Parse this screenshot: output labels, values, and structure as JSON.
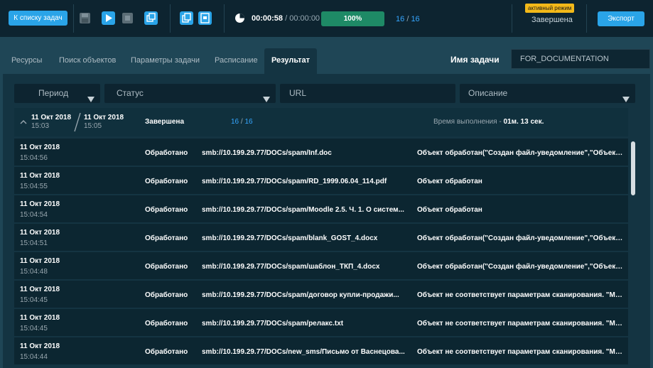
{
  "toolbar": {
    "back_label": "К списку задач",
    "time_current": "00:00:58",
    "time_separator": "/",
    "time_total": "00:00:00",
    "progress_label": "100%",
    "progress_value": 1.0,
    "count_done": "16",
    "count_separator": "/",
    "count_total": "16",
    "mode_badge": "активный режим",
    "mode_status": "Завершена",
    "export_label": "Экспорт",
    "icons": [
      "save-icon",
      "play-icon",
      "stop-icon",
      "copy-windows-icon",
      "copy-icon",
      "document-icon",
      "timer-icon"
    ]
  },
  "tabs": [
    {
      "label": "Ресурсы"
    },
    {
      "label": "Поиск объектов"
    },
    {
      "label": "Параметры задачи"
    },
    {
      "label": "Расписание"
    },
    {
      "label": "Результат",
      "active": true
    }
  ],
  "task": {
    "name_label": "Имя задачи",
    "name_value": "FOR_DOCUMENTATION"
  },
  "filters": {
    "period": "Период",
    "status": "Статус",
    "url": "URL",
    "description": "Описание"
  },
  "group": {
    "start_date": "11 Окт 2018",
    "start_time": "15:03",
    "end_date": "11 Окт 2018",
    "end_time": "15:05",
    "status": "Завершена",
    "count_done": "16",
    "count_separator": "/",
    "count_total": "16",
    "exec_label": "Время выполнения",
    "exec_dash": "-",
    "exec_value": "01м. 13 сек."
  },
  "rows": [
    {
      "date": "11 Окт 2018",
      "time": "15:04:56",
      "status": "Обработано",
      "url": "smb://10.199.29.77/DOCs/spam/Inf.doc",
      "desc": "Объект обработан(\"Создан файл-уведомление\",\"Объект п..."
    },
    {
      "date": "11 Окт 2018",
      "time": "15:04:55",
      "status": "Обработано",
      "url": "smb://10.199.29.77/DOCs/spam/RD_1999.06.04_114.pdf",
      "desc": "Объект обработан"
    },
    {
      "date": "11 Окт 2018",
      "time": "15:04:54",
      "status": "Обработано",
      "url": "smb://10.199.29.77/DOCs/spam/Moodle 2.5. Ч. 1. О систем...",
      "desc": "Объект обработан"
    },
    {
      "date": "11 Окт 2018",
      "time": "15:04:51",
      "status": "Обработано",
      "url": "smb://10.199.29.77/DOCs/spam/blank_GOST_4.docx",
      "desc": "Объект обработан(\"Создан файл-уведомление\",\"Объект п..."
    },
    {
      "date": "11 Окт 2018",
      "time": "15:04:48",
      "status": "Обработано",
      "url": "smb://10.199.29.77/DOCs/spam/шаблон_ТКП_4.docx",
      "desc": "Объект обработан(\"Создан файл-уведомление\",\"Объект п..."
    },
    {
      "date": "11 Окт 2018",
      "time": "15:04:45",
      "status": "Обработано",
      "url": "smb://10.199.29.77/DOCs/spam/договор купли-продажи...",
      "desc": "Объект не соответствует параметрам сканирования. \"Мет..."
    },
    {
      "date": "11 Окт 2018",
      "time": "15:04:45",
      "status": "Обработано",
      "url": "smb://10.199.29.77/DOCs/spam/релакс.txt",
      "desc": "Объект не соответствует параметрам сканирования. \"Мет..."
    },
    {
      "date": "11 Окт 2018",
      "time": "15:04:44",
      "status": "Обработано",
      "url": "smb://10.199.29.77/DOCs/new_sms/Письмо от Васнецова...",
      "desc": "Объект не соответствует параметрам сканирования. \"Мет..."
    }
  ],
  "colors": {
    "accent_blue": "#2aa4e8",
    "progress_green": "#1e8a66",
    "badge_yellow": "#f3b919",
    "count_blue": "#35a6ff"
  }
}
